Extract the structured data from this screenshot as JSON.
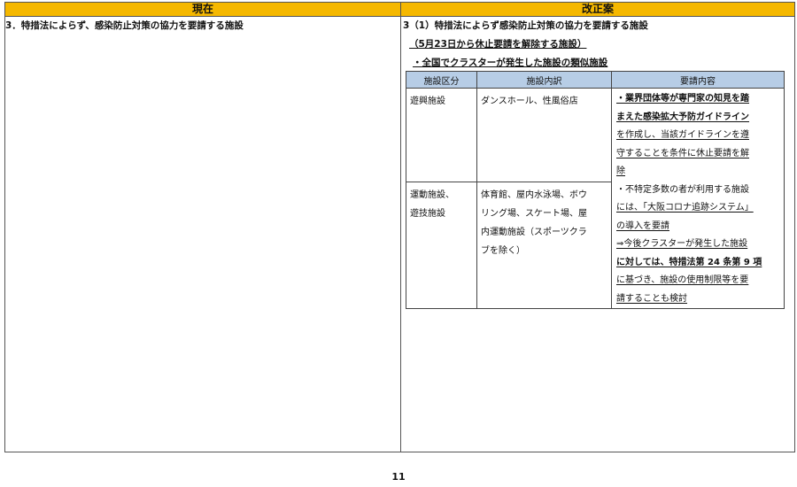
{
  "header": {
    "current": "現在",
    "revised": "改正案"
  },
  "left": {
    "title": "3．特措法によらず、感染防止対策の協力を要請する施設"
  },
  "right": {
    "title": "3（1）特措法によらず感染防止対策の協力を要請する施設",
    "subtitle": "（5月23日から休止要請を解除する施設）",
    "bullet": "・全国でクラスターが発生した施設の類似施設"
  },
  "table": {
    "headers": [
      "施設区分",
      "施設内訳",
      "要請内容"
    ],
    "rows": [
      {
        "category_lines": [
          "遊興施設"
        ],
        "breakdown_lines": [
          "ダンスホール、性風俗店"
        ]
      },
      {
        "category_lines": [
          "運動施設、",
          "遊技施設"
        ],
        "breakdown_lines": [
          "体育館、屋内水泳場、ボウ",
          "リング場、スケート場、屋",
          "内運動施設（スポーツクラ",
          "ブを除く）"
        ]
      }
    ],
    "requests": [
      "・業界団体等が専門家の知見を踏",
      "まえた感染拡大予防ガイドライン",
      "を作成し、当該ガイドラインを遵",
      "守することを条件に休止要請を解",
      "除",
      "・不特定多数の者が利用する施設",
      "には、「大阪コロナ追跡システム」",
      "の導入を要請",
      "⇒今後クラスターが発生した施設",
      "に対しては、特措法第 24 条第 9 項",
      "に基づき、施設の使用制限等を要",
      "請することも検討"
    ]
  },
  "footer": {
    "page_number": "11"
  }
}
